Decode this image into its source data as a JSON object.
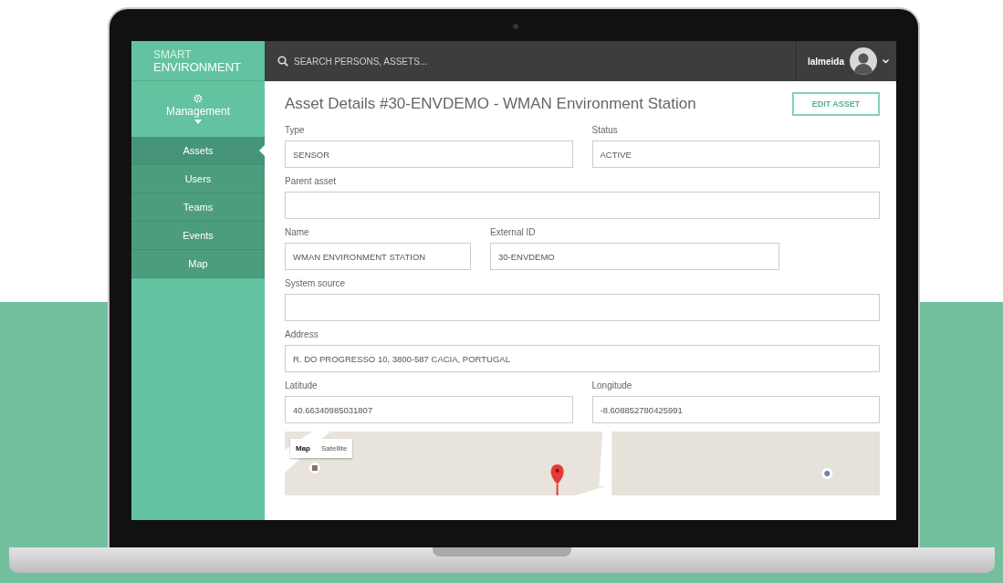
{
  "brand": {
    "line_1": "SMART",
    "line_2": "ENVIRONMENT"
  },
  "sidebar": {
    "section": "Management",
    "items": [
      {
        "label": "Assets",
        "selected": true
      },
      {
        "label": "Users",
        "selected": false
      },
      {
        "label": "Teams",
        "selected": false
      },
      {
        "label": "Events",
        "selected": false
      },
      {
        "label": "Map",
        "selected": false
      }
    ]
  },
  "top_bar": {
    "search": {
      "placeholder": "SEARCH PERSONS, ASSETS..."
    },
    "user": "lalmeida"
  },
  "page": {
    "title": "Asset Details #30-ENVDEMO - WMAN Environment Station",
    "action": "EDIT ASSET"
  },
  "form": {
    "rows": [
      {
        "kind": "half",
        "fields": [
          {
            "label": "Type",
            "value": "SENSOR"
          },
          {
            "label": "Status",
            "value": "ACTIVE"
          }
        ]
      },
      {
        "kind": "full",
        "fields": [
          {
            "label": "Parent asset"
          }
        ]
      },
      {
        "kind": "narrow",
        "fields": [
          {
            "label": "Name",
            "value": "WMAN ENVIRONMENT STATION"
          },
          {
            "label": "External ID",
            "value": "30-ENVDEMO"
          }
        ]
      },
      {
        "kind": "full",
        "fields": [
          {
            "label": "System source"
          }
        ]
      },
      {
        "kind": "full",
        "fields": [
          {
            "label": "Address",
            "value": "R. DO PROGRESSO 10, 3800-587 CACIA, PORTUGAL"
          }
        ]
      },
      {
        "kind": "half",
        "fields": [
          {
            "label": "Latitude",
            "value": "40.66340985031807"
          },
          {
            "label": "Longitude",
            "value": "-8.608852780425991"
          }
        ]
      }
    ]
  },
  "map": {
    "kind": "picture",
    "controls": [
      {
        "label": "Map",
        "selected": true
      },
      {
        "label": "Satellite",
        "selected": false
      }
    ]
  }
}
